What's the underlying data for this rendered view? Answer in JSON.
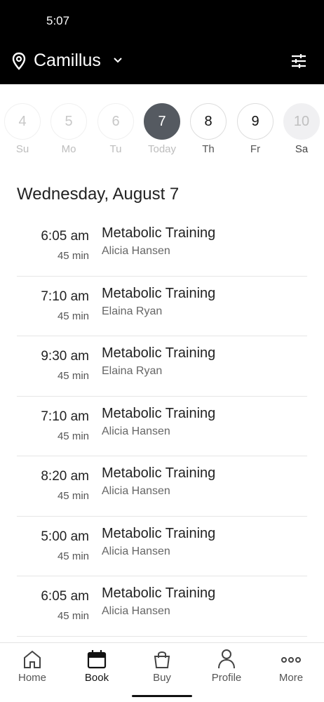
{
  "status_bar": {
    "time": "5:07"
  },
  "header": {
    "location": "Camillus",
    "location_icon": "map-pin-icon",
    "dropdown_icon": "chevron-down-icon",
    "filter_icon": "sliders-icon"
  },
  "week": [
    {
      "number": "4",
      "label": "Su",
      "state": "past"
    },
    {
      "number": "5",
      "label": "Mo",
      "state": "past"
    },
    {
      "number": "6",
      "label": "Tu",
      "state": "past"
    },
    {
      "number": "7",
      "label": "Today",
      "state": "selected"
    },
    {
      "number": "8",
      "label": "Th",
      "state": "normal"
    },
    {
      "number": "9",
      "label": "Fr",
      "state": "normal"
    },
    {
      "number": "10",
      "label": "Sa",
      "state": "disabled"
    }
  ],
  "date_heading": "Wednesday, August 7",
  "classes": [
    {
      "time": "6:05 am",
      "duration": "45 min",
      "name": "Metabolic Training",
      "instructor": "Alicia Hansen"
    },
    {
      "time": "7:10 am",
      "duration": "45 min",
      "name": "Metabolic Training",
      "instructor": "Elaina Ryan"
    },
    {
      "time": "9:30 am",
      "duration": "45 min",
      "name": "Metabolic Training",
      "instructor": "Elaina Ryan"
    },
    {
      "time": "7:10 am",
      "duration": "45 min",
      "name": "Metabolic Training",
      "instructor": "Alicia Hansen"
    },
    {
      "time": "8:20 am",
      "duration": "45 min",
      "name": "Metabolic Training",
      "instructor": "Alicia Hansen"
    },
    {
      "time": "5:00 am",
      "duration": "45 min",
      "name": "Metabolic Training",
      "instructor": "Alicia Hansen"
    },
    {
      "time": "6:05 am",
      "duration": "45 min",
      "name": "Metabolic Training",
      "instructor": "Alicia Hansen"
    }
  ],
  "tabbar": {
    "active": "Book",
    "tabs": [
      {
        "label": "Home",
        "icon": "home-icon"
      },
      {
        "label": "Book",
        "icon": "calendar-icon"
      },
      {
        "label": "Buy",
        "icon": "shopping-bag-icon"
      },
      {
        "label": "Profile",
        "icon": "person-icon"
      },
      {
        "label": "More",
        "icon": "more-dots-icon"
      }
    ]
  },
  "colors": {
    "header_bg": "#000000",
    "selected_day": "#555a61",
    "text_primary": "#222222",
    "text_secondary": "#666666"
  }
}
